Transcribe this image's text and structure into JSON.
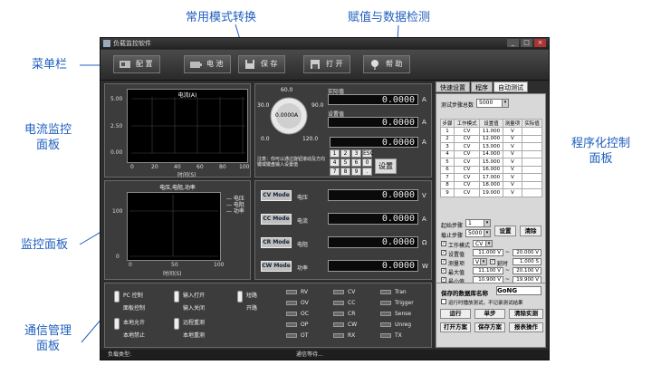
{
  "callouts": {
    "menubar": "菜单栏",
    "mode_switch": "常用模式转换",
    "assign_detect": "赋值与数据检测",
    "current_monitor": [
      "电流监控",
      "面板"
    ],
    "monitor_panel": "监控面板",
    "program_panel": [
      "程序化控制",
      "面板"
    ],
    "comm_panel": [
      "通信管理",
      "面板"
    ]
  },
  "window": {
    "title": "负载监控软件"
  },
  "toolbar": {
    "items": [
      {
        "label": "配 置",
        "icon": "config-icon"
      },
      {
        "label": "电 池",
        "icon": "battery-icon"
      },
      {
        "label": "保 存",
        "icon": "save-icon"
      },
      {
        "label": "打 开",
        "icon": "open-icon"
      },
      {
        "label": "帮 助",
        "icon": "help-icon"
      }
    ]
  },
  "current_plot": {
    "title": "电流(A)",
    "xlabel": "时间(S)",
    "yticks": [
      "5.00",
      "2.50",
      "0.00"
    ],
    "xticks": [
      "0",
      "20",
      "40",
      "60",
      "80",
      "100"
    ]
  },
  "vip_plot": {
    "title": "电压,电阻,功率",
    "xlabel": "时间(S)",
    "yticks": [
      "100",
      "0"
    ],
    "xticks": [
      "0",
      "50",
      "100"
    ],
    "legend": [
      "电压",
      "电阻",
      "功率"
    ]
  },
  "knob": {
    "label": "0.0000A",
    "ticks": [
      "60.0",
      "30.0",
      "90.0",
      "0.0",
      "120.0"
    ]
  },
  "measure": {
    "label": "实际值",
    "value": "0.0000",
    "unit": "A"
  },
  "setvalue": {
    "label": "设置值",
    "value": "0.0000",
    "unit": "A"
  },
  "input_display": {
    "value": "0.0000",
    "unit": "A"
  },
  "keypad": [
    "1",
    "2",
    "3",
    "ESC",
    "4",
    "5",
    "6",
    "0",
    "7",
    "8",
    "9",
    "."
  ],
  "set_button": "设置",
  "note": "注意：你可以通过旋钮滚动及方向键或键盘输入设置值",
  "modes": [
    {
      "button": "CV Mode",
      "label": "电压",
      "value": "0.0000",
      "unit": "V"
    },
    {
      "button": "CC Mode",
      "label": "电流",
      "value": "0.0000",
      "unit": "A"
    },
    {
      "button": "CR Mode",
      "label": "电阻",
      "value": "0.0000",
      "unit": "Ω"
    },
    {
      "button": "CW Mode",
      "label": "功率",
      "value": "0.0000",
      "unit": "W"
    }
  ],
  "comm": {
    "toggles": [
      {
        "top": "PC 控制",
        "bottom": "面板控制"
      },
      {
        "top": "输入打开",
        "bottom": "输入关闭"
      },
      {
        "top": "短路",
        "bottom": "开路"
      },
      {
        "top": "本地允许",
        "bottom": "本地禁止"
      },
      {
        "top": "远程重测",
        "bottom": "本地重测"
      }
    ],
    "leds": [
      "RV",
      "CV",
      "Tran",
      "OV",
      "CC",
      "Trigger",
      "OC",
      "CR",
      "Sense",
      "OP",
      "CW",
      "Unreg",
      "OT",
      "RX",
      "TX"
    ]
  },
  "tabs": [
    "快速设置",
    "程序",
    "自动测试"
  ],
  "autotest": {
    "total_label": "测试步骤总数",
    "total_value": "5000",
    "columns": [
      "步骤",
      "工作模式",
      "设置值",
      "测量项",
      "实际值"
    ],
    "rows": [
      [
        "1",
        "CV",
        "11.000",
        "V",
        ""
      ],
      [
        "2",
        "CV",
        "12.000",
        "V",
        ""
      ],
      [
        "3",
        "CV",
        "13.000",
        "V",
        ""
      ],
      [
        "4",
        "CV",
        "14.000",
        "V",
        ""
      ],
      [
        "5",
        "CV",
        "15.000",
        "V",
        ""
      ],
      [
        "6",
        "CV",
        "16.000",
        "V",
        ""
      ],
      [
        "7",
        "CV",
        "17.000",
        "V",
        ""
      ],
      [
        "8",
        "CV",
        "18.000",
        "V",
        ""
      ],
      [
        "9",
        "CV",
        "19.000",
        "V",
        ""
      ]
    ],
    "start_label": "起始步骤",
    "start_value": "1",
    "load_label": "载止步骤",
    "load_value": "5000",
    "set_btn": "设置",
    "clear_btn": "清除",
    "mode_label": "工作模式",
    "mode_value": "CV",
    "setval_label": "设置值",
    "setval_a": "11.000 V",
    "setval_b": "20.000 V",
    "measure_label": "测量项",
    "measure_value": "V",
    "delay_label": "延时",
    "delay_value": "1.000 S",
    "max_label": "最大值",
    "max_a": "11.100 V",
    "max_b": "20.100 V",
    "min_label": "最小值",
    "min_a": "10.900 V",
    "min_b": "19.900 V"
  },
  "save_area": {
    "name_label": "保存的数据库名称",
    "name_value": "GoNG",
    "option": "运行时播放测试，不记录测试结果",
    "buttons": [
      "运行",
      "单步",
      "清除实测",
      "打开方案",
      "保存方案",
      "报表操作"
    ]
  },
  "status": {
    "left": "负载类型:",
    "center": "通信等待..."
  }
}
